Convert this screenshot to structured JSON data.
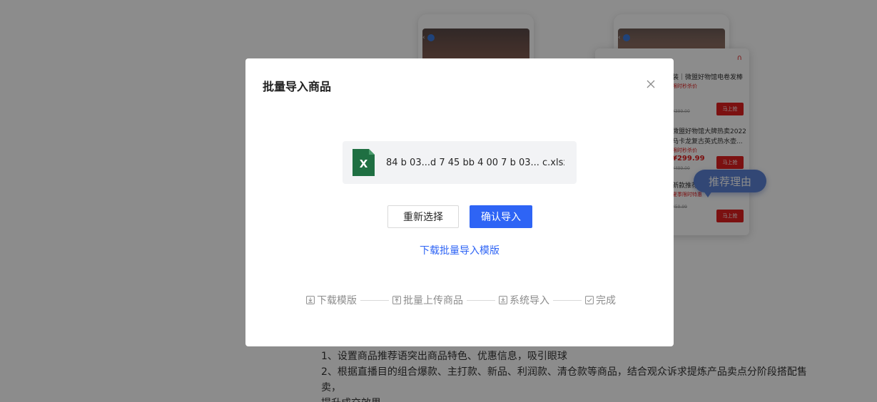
{
  "modal": {
    "title": "批量导入商品",
    "file_name": "84 b 03...d   7 45 bb 4 00  7 b 03...  c.xlsx",
    "file_icon_letter": "X",
    "reselect_label": "重新选择",
    "confirm_label": "确认导入",
    "download_template_link": "下载批量导入模版",
    "steps": [
      {
        "icon": "download-icon",
        "label": "下载模版"
      },
      {
        "icon": "upload-icon",
        "label": "批量上传商品"
      },
      {
        "icon": "import-icon",
        "label": "系统导入"
      },
      {
        "icon": "check-icon",
        "label": "完成"
      }
    ]
  },
  "background": {
    "reason_bubble": "推荐理由",
    "tips": [
      "1、设置商品推荐语突出商品特色、优惠信息，吸引眼球",
      "2、根据直播目的组合爆款、主打款、新品、利润款、清仓款等商品，结合观众诉求提炼产品卖点分阶段搭配售卖，",
      "提升成交效果"
    ],
    "product_items": [
      {
        "title": "装｜微盟好物馆电卷发棒",
        "tag": "限时秒杀价",
        "old_price": "¥399.00",
        "button": "马上抢"
      },
      {
        "title": "微盟好物馆大牌热卖2022马卡龙复古英式热水壶...",
        "tag": "限时秒杀价",
        "price": "¥299.99",
        "old_price": "¥499.00",
        "button": "马上抢"
      },
      {
        "title": "新款推荐…全棉浴巾",
        "tag": "夏季限时特惠",
        "old_price": "¥59.99",
        "button": "马上抢"
      }
    ]
  },
  "colors": {
    "primary": "#2e64f5",
    "excel_green": "#1f6f42",
    "mask": "rgba(0,0,0,0.45)",
    "sale_red": "#e01f1f"
  }
}
